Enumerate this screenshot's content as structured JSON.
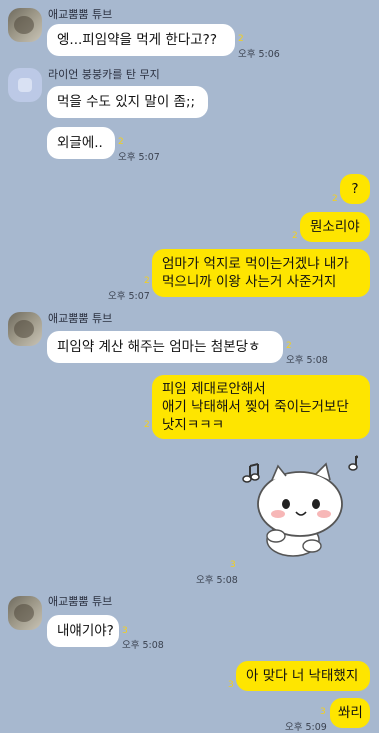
{
  "messages": {
    "m1": {
      "sender": "애교뿜뿜 튜브",
      "text": "엥...피임약을 먹게 한다고??",
      "unread": "2",
      "time": "오후 5:06"
    },
    "m2": {
      "sender": "라이언 붕붕카를 탄 무지",
      "text": "먹을 수도 있지 말이 좀;;"
    },
    "m3": {
      "text": "외글에..",
      "unread": "2",
      "time": "오후 5:07"
    },
    "m4": {
      "text": "?",
      "unread": "2"
    },
    "m5": {
      "text": "뭔소리야",
      "unread": "2"
    },
    "m6": {
      "text": "엄마가 억지로 먹이는거겠냐 내가\n먹으니까 이왕 사는거 사준거지",
      "unread": "2",
      "time": "오후 5:07"
    },
    "m7": {
      "sender": "애교뿜뿜 튜브",
      "text": "피임약 계산 해주는 엄마는 첨본당ㅎ",
      "unread": "2",
      "time": "오후 5:08"
    },
    "m8": {
      "text": "피임 제대로안해서\n애기 낙태해서 찢어 죽이는거보단\n낫지ㅋㅋㅋ",
      "unread": "2"
    },
    "m9": {
      "unread": "3",
      "time": "오후 5:08"
    },
    "m10": {
      "sender": "애교뿜뿜 튜브",
      "text": "내얘기야?",
      "unread": "3",
      "time": "오후 5:08"
    },
    "m11": {
      "text": "아 맞다 너 낙태했지",
      "unread": "3"
    },
    "m12": {
      "text": "쏴리",
      "unread": "3",
      "time": "오후 5:09"
    }
  },
  "colors": {
    "background": "#a7b8cf",
    "my_bubble": "#fee500",
    "their_bubble": "#ffffff",
    "unread": "#f3d01e"
  },
  "icons": {
    "avatar_tube": "avatar",
    "avatar_muzi": "avatar-placeholder",
    "sticker": "cat-sticker-icon"
  }
}
